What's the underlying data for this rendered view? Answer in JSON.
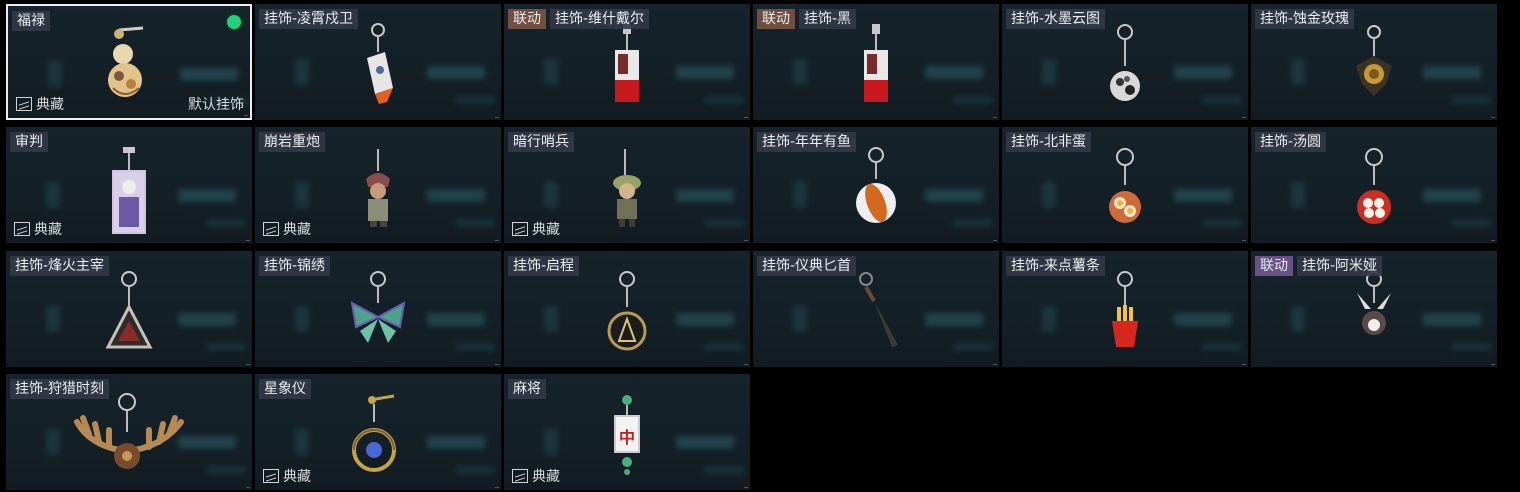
{
  "cards": [
    {
      "id": "fulu",
      "tags": [
        {
          "text": "福禄",
          "kind": "plain"
        }
      ],
      "collect": "典藏",
      "default": "默认挂饰",
      "selected": true,
      "icon": "gourd-charm-icon"
    },
    {
      "id": "lingxiao",
      "tags": [
        {
          "text": "挂饰-凌霄戍卫",
          "kind": "plain"
        }
      ],
      "icon": "rocket-charm-icon"
    },
    {
      "id": "weishi",
      "tags": [
        {
          "text": "联动",
          "kind": "collab"
        },
        {
          "text": "挂饰-维什戴尔",
          "kind": "plain"
        }
      ],
      "icon": "tag-card-red-charm-icon"
    },
    {
      "id": "hei",
      "tags": [
        {
          "text": "联动",
          "kind": "collab"
        },
        {
          "text": "挂饰-黑",
          "kind": "plain"
        }
      ],
      "icon": "tag-card-red-charm-icon"
    },
    {
      "id": "shuimo",
      "tags": [
        {
          "text": "挂饰-水墨云图",
          "kind": "plain"
        }
      ],
      "icon": "ink-ball-charm-icon"
    },
    {
      "id": "shijin",
      "tags": [
        {
          "text": "挂饰-蚀金玫瑰",
          "kind": "plain"
        }
      ],
      "icon": "gold-rose-charm-icon"
    },
    {
      "id": "shenpan",
      "tags": [
        {
          "text": "审判",
          "kind": "plain"
        }
      ],
      "collect": "典藏",
      "icon": "judgement-card-charm-icon"
    },
    {
      "id": "bengyan",
      "tags": [
        {
          "text": "崩岩重炮",
          "kind": "plain"
        }
      ],
      "collect": "典藏",
      "icon": "figure-charm-icon"
    },
    {
      "id": "anxing",
      "tags": [
        {
          "text": "暗行哨兵",
          "kind": "plain"
        }
      ],
      "collect": "典藏",
      "icon": "sentinel-figure-charm-icon"
    },
    {
      "id": "niannian",
      "tags": [
        {
          "text": "挂饰-年年有鱼",
          "kind": "plain"
        }
      ],
      "icon": "fish-plate-charm-icon"
    },
    {
      "id": "beifei",
      "tags": [
        {
          "text": "挂饰-北非蛋",
          "kind": "plain"
        }
      ],
      "icon": "egg-pan-charm-icon"
    },
    {
      "id": "tangyuan",
      "tags": [
        {
          "text": "挂饰-汤圆",
          "kind": "plain"
        }
      ],
      "icon": "tangyuan-bowl-charm-icon"
    },
    {
      "id": "fenghuo",
      "tags": [
        {
          "text": "挂饰-烽火主宰",
          "kind": "plain"
        }
      ],
      "icon": "triangle-emblem-charm-icon"
    },
    {
      "id": "jinxiu",
      "tags": [
        {
          "text": "挂饰-锦绣",
          "kind": "plain"
        }
      ],
      "icon": "butterfly-charm-icon"
    },
    {
      "id": "qicheng",
      "tags": [
        {
          "text": "挂饰-启程",
          "kind": "plain"
        }
      ],
      "icon": "coin-charm-icon"
    },
    {
      "id": "yidian",
      "tags": [
        {
          "text": "挂饰-仪典匕首",
          "kind": "plain"
        }
      ],
      "icon": "dagger-charm-icon"
    },
    {
      "id": "laidian",
      "tags": [
        {
          "text": "挂饰-来点薯条",
          "kind": "plain"
        }
      ],
      "icon": "fries-charm-icon"
    },
    {
      "id": "amiya",
      "tags": [
        {
          "text": "联动",
          "kind": "collab-purple"
        },
        {
          "text": "挂饰-阿米娅",
          "kind": "plain"
        }
      ],
      "icon": "rabbit-charm-icon"
    },
    {
      "id": "shoulie",
      "tags": [
        {
          "text": "挂饰-狩猎时刻",
          "kind": "plain"
        }
      ],
      "icon": "antler-charm-icon"
    },
    {
      "id": "xingxiang",
      "tags": [
        {
          "text": "星象仪",
          "kind": "plain"
        }
      ],
      "collect": "典藏",
      "icon": "astrolabe-charm-icon"
    },
    {
      "id": "majiang",
      "tags": [
        {
          "text": "麻将",
          "kind": "plain"
        }
      ],
      "collect": "典藏",
      "icon": "mahjong-tile-charm-icon",
      "tile_char": "中"
    }
  ]
}
